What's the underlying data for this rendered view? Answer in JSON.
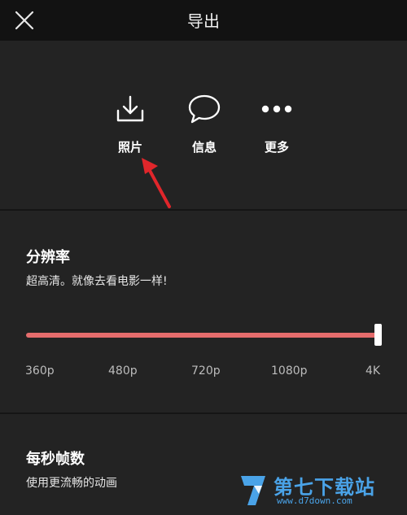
{
  "header": {
    "title": "导出"
  },
  "share": {
    "items": [
      {
        "label": "照片",
        "icon": "download-icon"
      },
      {
        "label": "信息",
        "icon": "chat-bubble-icon"
      },
      {
        "label": "更多",
        "icon": "more-dots-icon"
      }
    ]
  },
  "resolution": {
    "title": "分辨率",
    "subtitle": "超高清。就像去看电影一样!",
    "options": [
      "360p",
      "480p",
      "720p",
      "1080p",
      "4K"
    ],
    "selected": "4K",
    "track_color": "#e56d6d"
  },
  "framerate": {
    "title": "每秒帧数",
    "subtitle": "使用更流畅的动画"
  },
  "watermark": {
    "text": "第七下载站",
    "url": "www.d7down.com"
  }
}
